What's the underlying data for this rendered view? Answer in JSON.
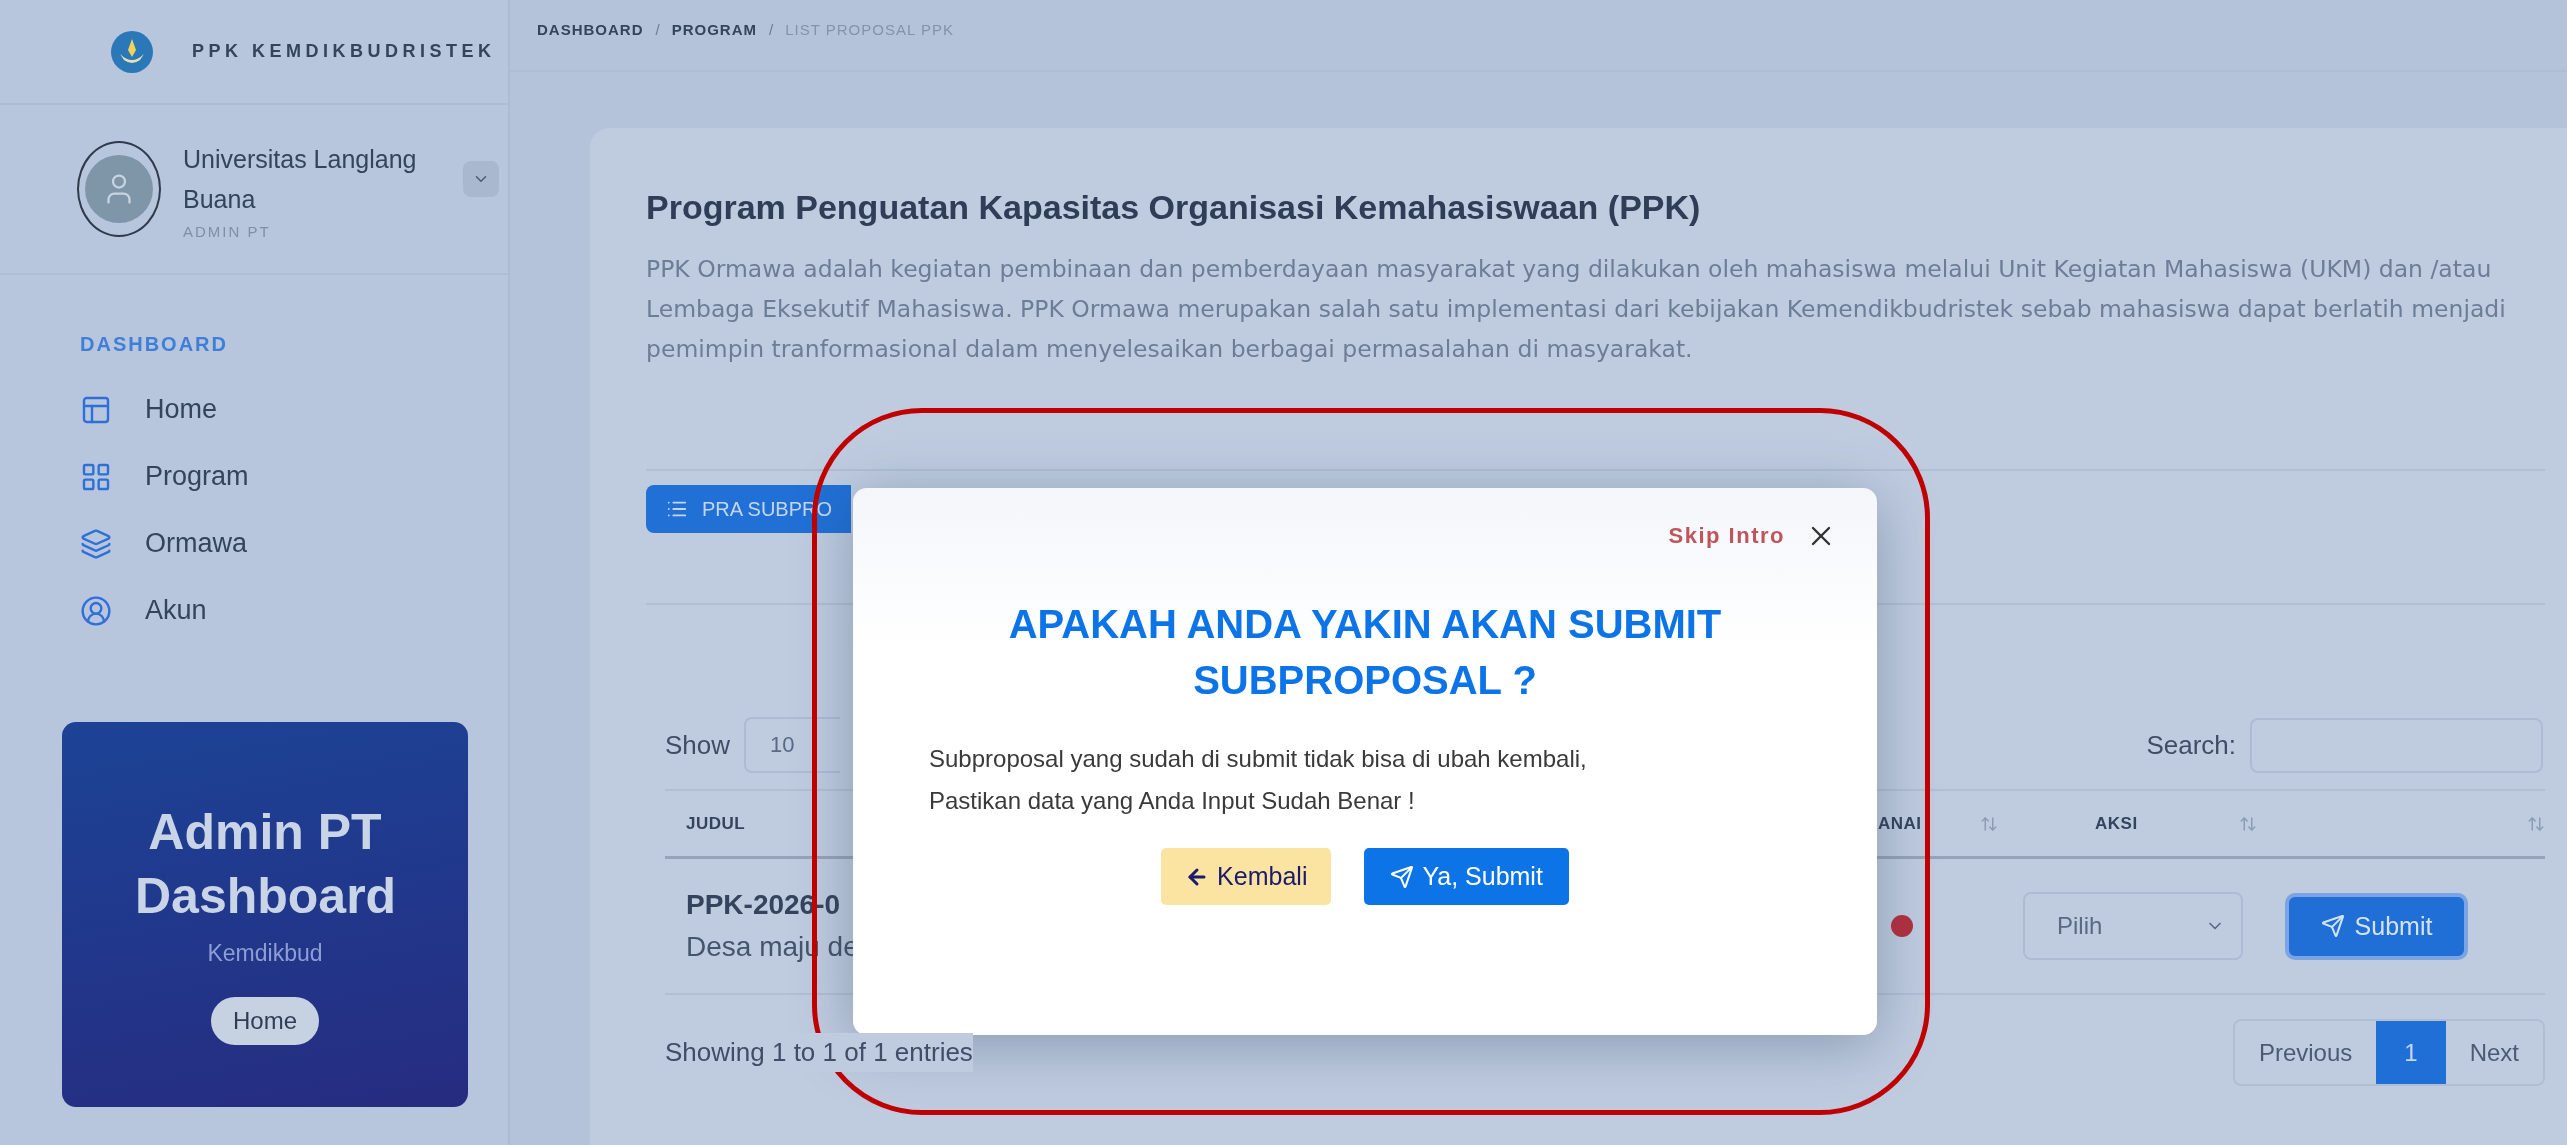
{
  "sidebar": {
    "brand": "PPK KEMDIKBUDRISTEK",
    "profile": {
      "name": "Universitas Langlang Buana",
      "role": "ADMIN PT"
    },
    "section": "DASHBOARD",
    "items": [
      {
        "label": "Home"
      },
      {
        "label": "Program"
      },
      {
        "label": "Ormawa"
      },
      {
        "label": "Akun"
      }
    ],
    "promo": {
      "title": "Admin PT Dashboard",
      "subtitle": "Kemdikbud",
      "button": "Home"
    }
  },
  "breadcrumb": [
    {
      "label": "DASHBOARD",
      "current": false
    },
    {
      "separator": "/",
      "label": "PROGRAM",
      "current": false
    },
    {
      "separator": "/",
      "label": "LIST PROPOSAL PPK",
      "current": true
    }
  ],
  "page": {
    "title": "Program Penguatan Kapasitas Organisasi Kemahasiswaan (PPK)",
    "description": "PPK Ormawa adalah kegiatan pembinaan dan pemberdayaan masyarakat yang dilakukan oleh mahasiswa melalui Unit Kegiatan Mahasiswa (UKM) dan /atau Lembaga Eksekutif Mahasiswa. PPK Ormawa merupakan salah satu implementasi dari kebijakan Kemendikbudristek sebab mahasiswa dapat berlatih menjadi pemimpin tranformasional dalam menyelesaikan berbagai permasalahan di masyarakat."
  },
  "toolbar_button": "PRA SUBPRO",
  "table": {
    "length_label": "Show",
    "length_value": "10",
    "search_label": "Search:",
    "columns": [
      {
        "label": "JUDUL",
        "sortable": false
      },
      {
        "label": "ANAI",
        "sortable": true
      },
      {
        "label": "AKSI",
        "sortable": true
      },
      {
        "sortable": true
      }
    ],
    "rows": [
      {
        "code": "PPK-2026-0",
        "title": "Desa maju de",
        "color": "#b3303f",
        "action_placeholder": "Pilih",
        "button": "Submit"
      }
    ],
    "info": "Showing 1 to 1 of 1 entries",
    "pagination": [
      {
        "label": "Previous",
        "selected": false
      },
      {
        "label": "1",
        "selected": true
      },
      {
        "label": "Next",
        "selected": false
      }
    ]
  },
  "dialog": {
    "skip": "Skip Intro",
    "title": "APAKAH ANDA YAKIN AKAN SUBMIT SUBPROPOSAL ?",
    "message": [
      "Subproposal yang sudah di submit tidak bisa di ubah kembali,",
      "Pastikan data yang Anda Input Sudah Benar !"
    ],
    "buttons": [
      {
        "label": "Kembali",
        "kind": "back"
      },
      {
        "label": "Ya, Submit",
        "kind": "confirm"
      }
    ]
  }
}
